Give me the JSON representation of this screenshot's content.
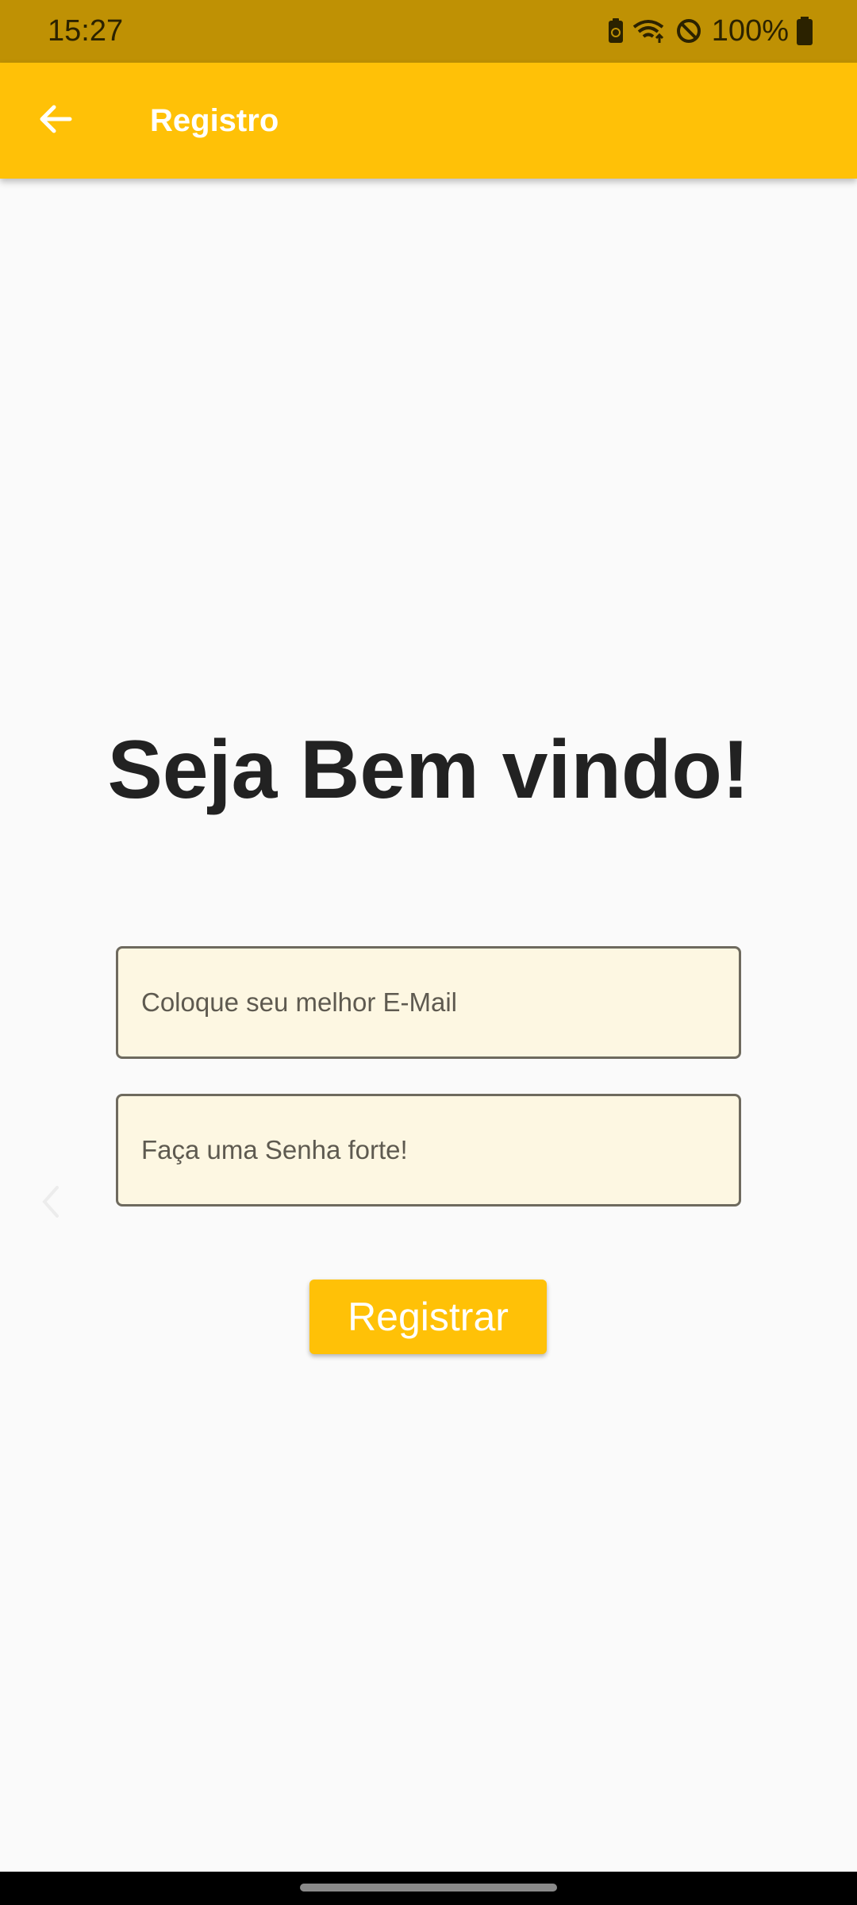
{
  "status_bar": {
    "time": "15:27",
    "battery": "100%",
    "icons": [
      "battery-saver-icon",
      "wifi-icon",
      "do-not-disturb-icon",
      "battery-icon"
    ]
  },
  "app_bar": {
    "title": "Registro",
    "back_icon": "arrow-back-icon",
    "color": "#ffc107"
  },
  "main": {
    "heading": "Seja Bem vindo!",
    "email_placeholder": "Coloque seu melhor E-Mail",
    "password_placeholder": "Faça uma Senha forte!",
    "register_label": "Registrar"
  },
  "colors": {
    "accent": "#ffc107",
    "status_bar": "#bf9104",
    "field_fill": "#fdf7e2"
  }
}
